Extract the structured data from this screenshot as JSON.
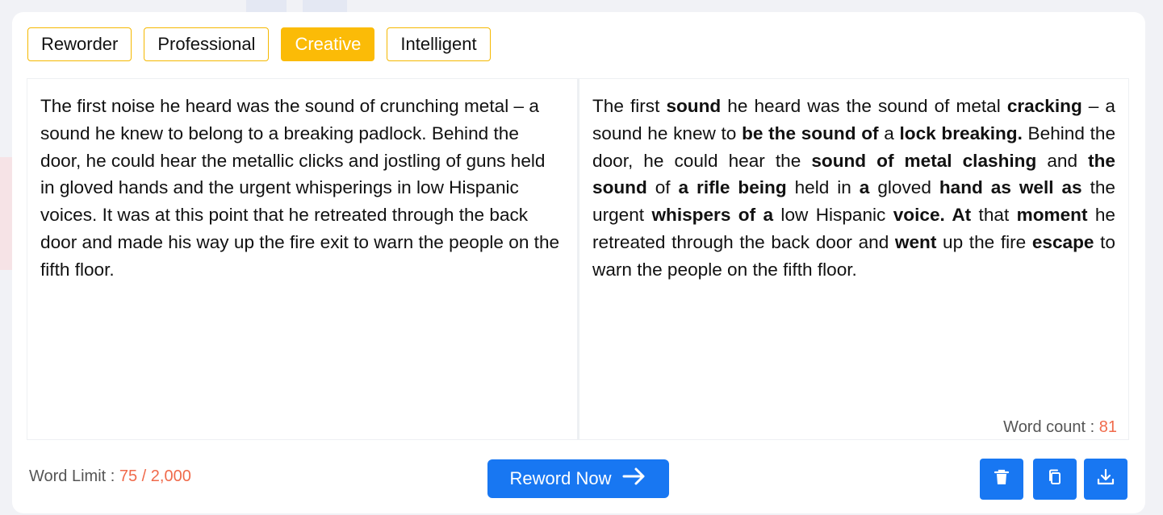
{
  "modes": [
    {
      "label": "Reworder",
      "active": false
    },
    {
      "label": "Professional",
      "active": false
    },
    {
      "label": "Creative",
      "active": true
    },
    {
      "label": "Intelligent",
      "active": false
    }
  ],
  "input": {
    "text": "The first noise he heard was the sound of crunching metal – a sound he knew to belong to a breaking padlock. Behind the door, he could hear the metallic clicks and jostling of guns held in gloved hands and the urgent whisperings in low Hispanic voices. It was at this point that he retreated through the back door and made his way up the fire exit to warn the people on the fifth floor."
  },
  "output": {
    "segments": [
      {
        "t": "The first ",
        "b": false
      },
      {
        "t": "sound",
        "b": true
      },
      {
        "t": " he heard was the sound of metal ",
        "b": false
      },
      {
        "t": "cracking",
        "b": true
      },
      {
        "t": " – a sound he knew to ",
        "b": false
      },
      {
        "t": "be the sound of",
        "b": true
      },
      {
        "t": " a ",
        "b": false
      },
      {
        "t": "lock breaking.",
        "b": true
      },
      {
        "t": " Behind the door, he could hear the ",
        "b": false
      },
      {
        "t": "sound of metal clashing",
        "b": true
      },
      {
        "t": " and ",
        "b": false
      },
      {
        "t": "the sound",
        "b": true
      },
      {
        "t": " of ",
        "b": false
      },
      {
        "t": "a rifle being",
        "b": true
      },
      {
        "t": " held in ",
        "b": false
      },
      {
        "t": "a",
        "b": true
      },
      {
        "t": " gloved ",
        "b": false
      },
      {
        "t": "hand as well as",
        "b": true
      },
      {
        "t": " the urgent ",
        "b": false
      },
      {
        "t": "whispers of a",
        "b": true
      },
      {
        "t": " low Hispanic ",
        "b": false
      },
      {
        "t": "voice. At",
        "b": true
      },
      {
        "t": " that ",
        "b": false
      },
      {
        "t": "moment",
        "b": true
      },
      {
        "t": " he retreated through the back door and ",
        "b": false
      },
      {
        "t": "went",
        "b": true
      },
      {
        "t": " up the fire ",
        "b": false
      },
      {
        "t": "escape",
        "b": true
      },
      {
        "t": " to warn the people on the fifth floor.",
        "b": false
      }
    ],
    "word_count_label": "Word count : ",
    "word_count": "81"
  },
  "footer": {
    "word_limit_label": "Word Limit : ",
    "word_limit_value": "75 / 2,000",
    "reword_label": "Reword Now",
    "reword_icon": "arrow-right-icon",
    "icons": [
      "trash-icon",
      "copy-icon",
      "download-icon"
    ]
  },
  "colors": {
    "accent_yellow": "#fbbb07",
    "primary_blue": "#1877f2",
    "count_orange": "#f06a4b"
  }
}
